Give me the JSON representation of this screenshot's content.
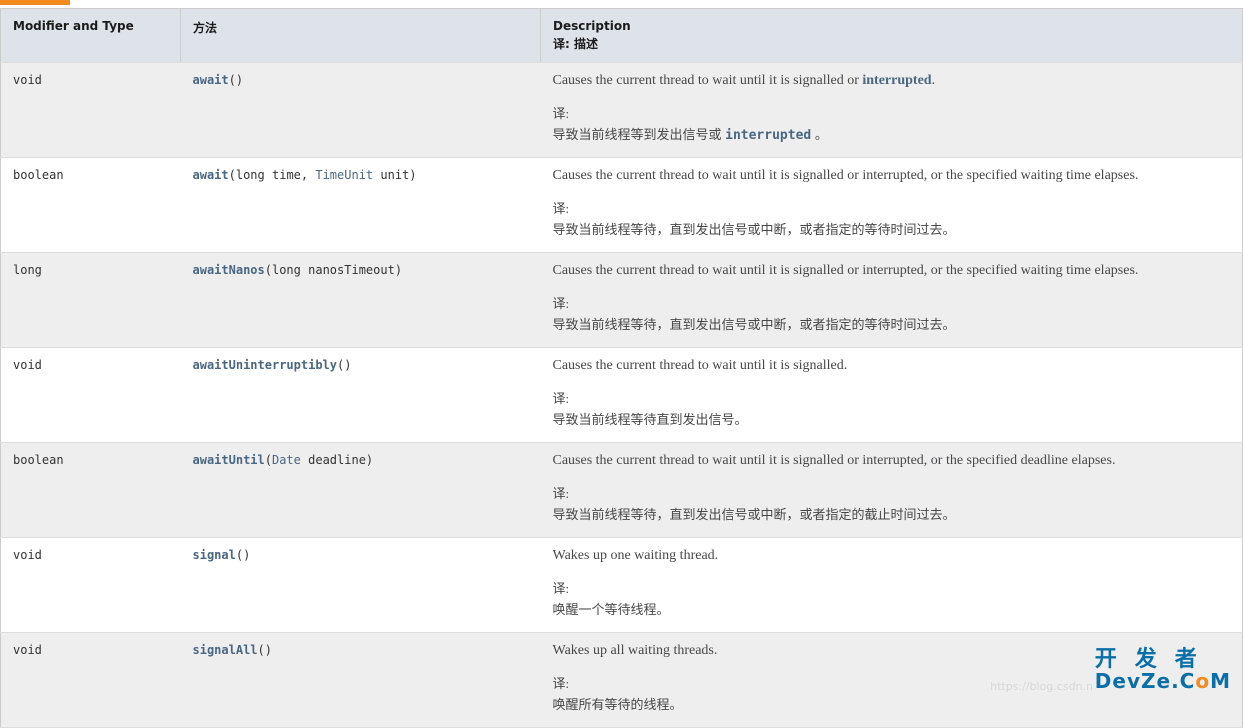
{
  "headers": {
    "col1": "Modifier and Type",
    "col2": "方法",
    "col3": "Description",
    "col3_sub": "译: 描述"
  },
  "rows": [
    {
      "type": "void",
      "method": "await",
      "params_html": "()",
      "desc_en_prefix": "Causes the current thread to wait until it is signalled or ",
      "desc_en_link": "interrupted",
      "desc_en_suffix": ".",
      "zh_label": "译:",
      "zh_prefix": "导致当前线程等到发出信号或 ",
      "zh_link": "interrupted",
      "zh_suffix": " 。"
    },
    {
      "type": "boolean",
      "method": "await",
      "params": [
        {
          "ptype": "long",
          "pname": "time",
          "link": false
        },
        {
          "ptype": "TimeUnit",
          "pname": "unit",
          "link": true
        }
      ],
      "desc_en": "Causes the current thread to wait until it is signalled or interrupted, or the specified waiting time elapses.",
      "zh_label": "译:",
      "zh": "导致当前线程等待，直到发出信号或中断，或者指定的等待时间过去。"
    },
    {
      "type": "long",
      "method": "awaitNanos",
      "params": [
        {
          "ptype": "long",
          "pname": "nanosTimeout",
          "link": false
        }
      ],
      "desc_en": "Causes the current thread to wait until it is signalled or interrupted, or the specified waiting time elapses.",
      "zh_label": "译:",
      "zh": "导致当前线程等待，直到发出信号或中断，或者指定的等待时间过去。"
    },
    {
      "type": "void",
      "method": "awaitUninterruptibly",
      "params_html": "()",
      "desc_en": "Causes the current thread to wait until it is signalled.",
      "zh_label": "译:",
      "zh": "导致当前线程等待直到发出信号。"
    },
    {
      "type": "boolean",
      "method": "awaitUntil",
      "params": [
        {
          "ptype": "Date",
          "pname": "deadline",
          "link": true
        }
      ],
      "desc_en": "Causes the current thread to wait until it is signalled or interrupted, or the specified deadline elapses.",
      "zh_label": "译:",
      "zh": "导致当前线程等待，直到发出信号或中断，或者指定的截止时间过去。"
    },
    {
      "type": "void",
      "method": "signal",
      "params_html": "()",
      "desc_en": "Wakes up one waiting thread.",
      "zh_label": "译:",
      "zh": "唤醒一个等待线程。"
    },
    {
      "type": "void",
      "method": "signalAll",
      "params_html": "()",
      "desc_en": "Wakes up all waiting threads.",
      "zh_label": "译:",
      "zh": "唤醒所有等待的线程。"
    }
  ],
  "watermark": {
    "cn": "开发者",
    "en_pre": "DevZe.C",
    "en_o": "o",
    "en_post": "M"
  },
  "faint_url": "https://blog.csdn.n"
}
